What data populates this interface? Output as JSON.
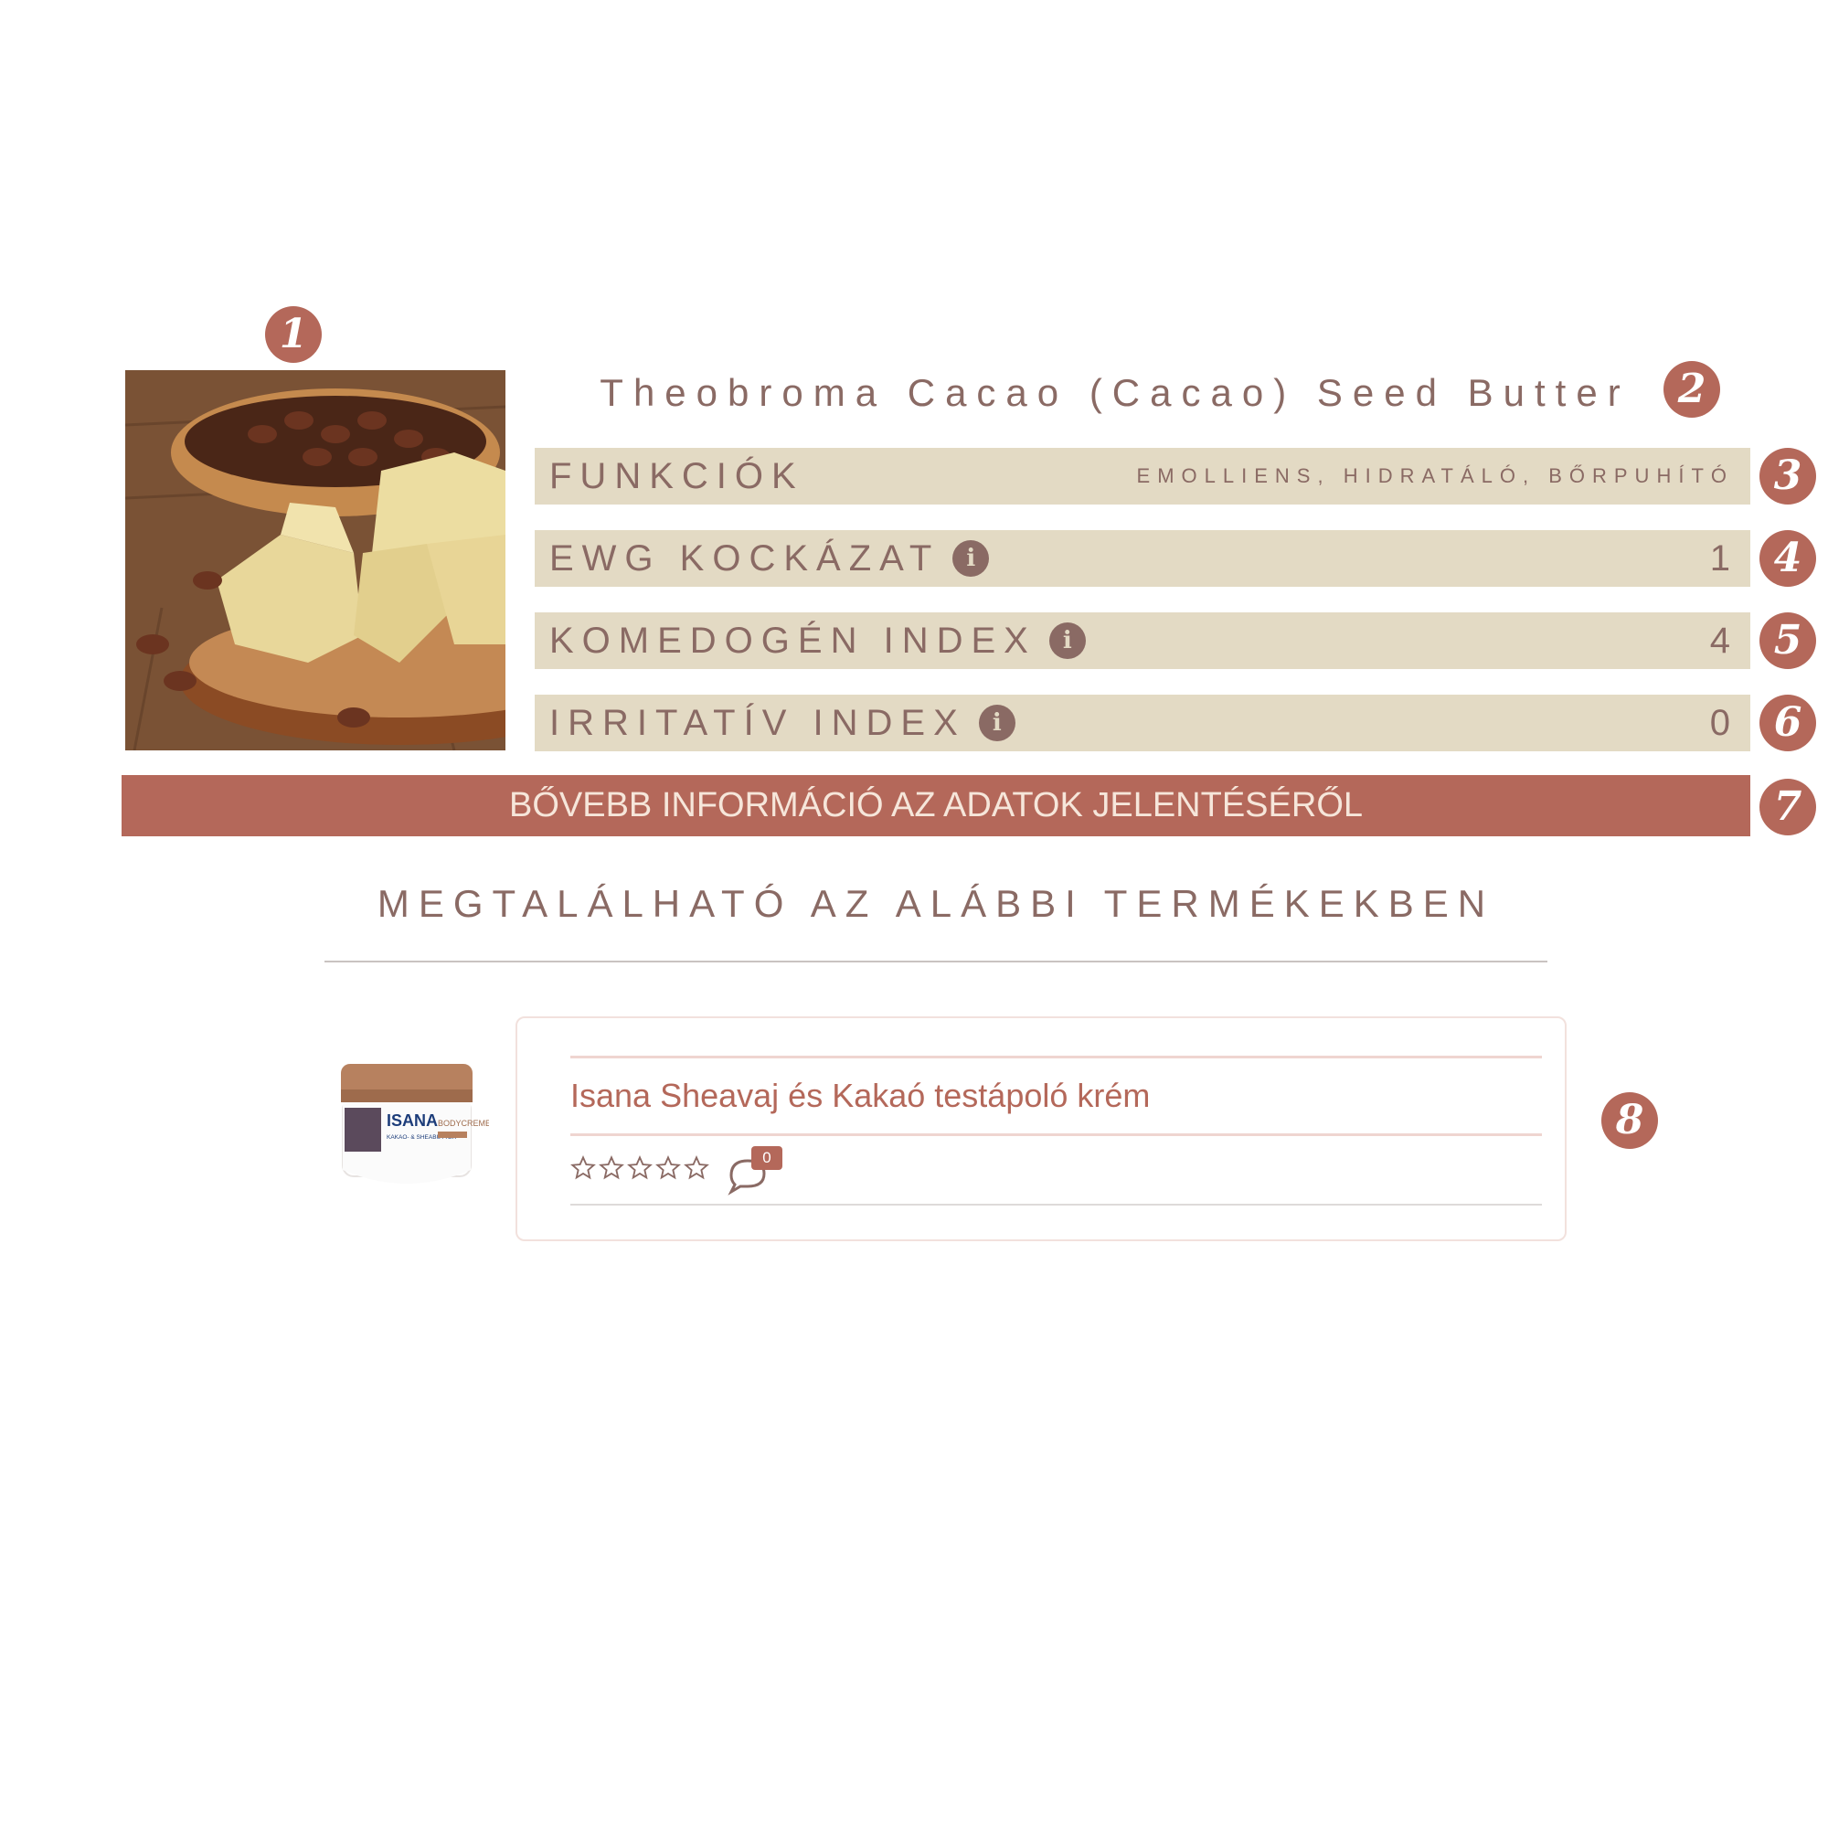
{
  "badges": [
    "1",
    "2",
    "3",
    "4",
    "5",
    "6",
    "7",
    "8"
  ],
  "ingredient": {
    "name": "Theobroma Cacao (Cacao) Seed Butter",
    "image_icon": "cocoa-butter-photo"
  },
  "properties": [
    {
      "label": "FUNKCIÓK",
      "value": "EMOLLIENS, HIDRATÁLÓ, BŐRPUHÍTÓ",
      "has_info": false
    },
    {
      "label": "EWG KOCKÁZAT",
      "value": "1",
      "has_info": true
    },
    {
      "label": "KOMEDOGÉN INDEX",
      "value": "4",
      "has_info": true
    },
    {
      "label": "IRRITATÍV INDEX",
      "value": "0",
      "has_info": true
    }
  ],
  "info_glyph": "i",
  "cta_label": "BŐVEBB INFORMÁCIÓ AZ ADATOK JELENTÉSÉRŐL",
  "products_section_title": "MEGTALÁLHATÓ AZ ALÁBBI TERMÉKEKBEN",
  "products": [
    {
      "name": "Isana Sheavaj és Kakaó testápoló krém",
      "rating": 0,
      "max_rating": 5,
      "comment_count": "0",
      "jar_brand": "ISANA",
      "jar_subtitle": "KAKAO- & SHEABUTTER",
      "jar_type": "BODYCREME"
    }
  ],
  "colors": {
    "accent": "#b4685a",
    "bar_bg": "#e3dac4",
    "text": "#8a6a64"
  }
}
